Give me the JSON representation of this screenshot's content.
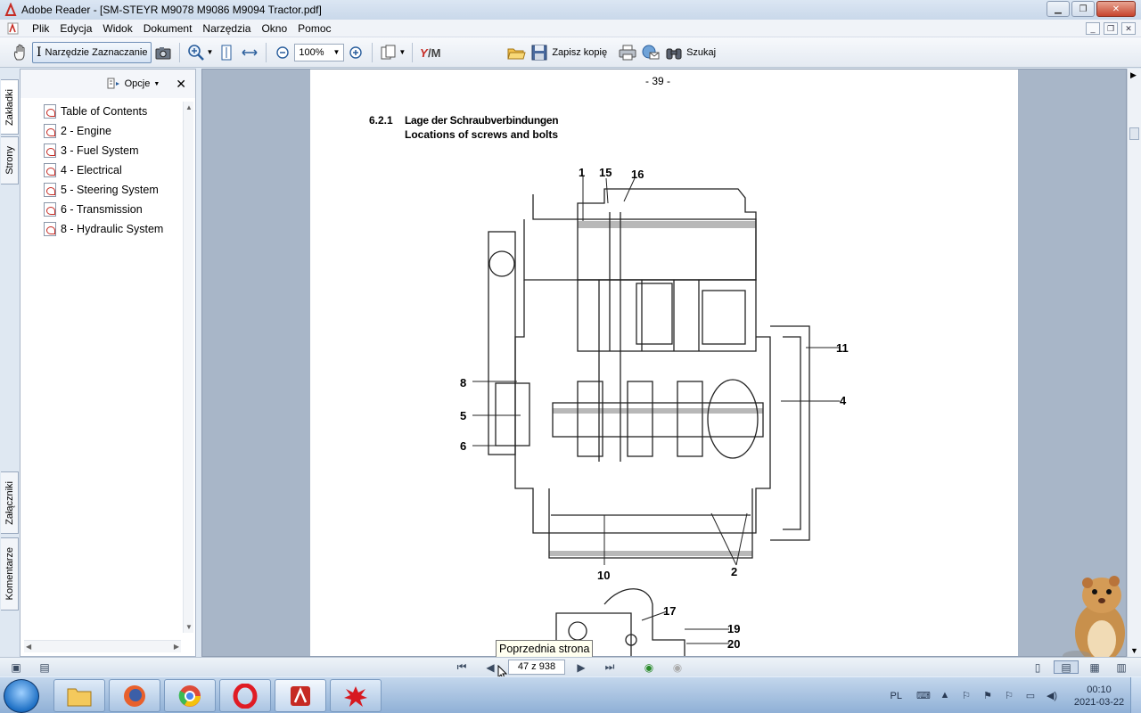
{
  "window": {
    "title": "Adobe Reader - [SM-STEYR M9078 M9086 M9094 Tractor.pdf]"
  },
  "menu": {
    "items": [
      "Plik",
      "Edycja",
      "Widok",
      "Dokument",
      "Narzędzia",
      "Okno",
      "Pomoc"
    ]
  },
  "toolbar": {
    "select_tool_label": "Narzędzie Zaznaczanie",
    "zoom_value": "100%",
    "save_copy_label": "Zapisz kopię",
    "search_label": "Szukaj"
  },
  "side_tabs": {
    "bookmarks": "Zakładki",
    "pages": "Strony",
    "attachments": "Załączniki",
    "comments": "Komentarze"
  },
  "bookmarks": {
    "options_label": "Opcje",
    "items": [
      "Table of Contents",
      "2 - Engine",
      "3 - Fuel System",
      "4 - Electrical",
      "5 - Steering System",
      "6 - Transmission",
      "8 - Hydraulic System"
    ]
  },
  "page": {
    "page_number_text": "- 39 -",
    "section_number": "6.2.1",
    "heading_de": "Lage der Schraubverbindungen",
    "heading_en": "Locations of screws and bolts",
    "callouts": [
      "1",
      "15",
      "16",
      "11",
      "4",
      "8",
      "5",
      "6",
      "10",
      "2",
      "17",
      "19",
      "20"
    ]
  },
  "tooltip": {
    "text": "Poprzednia strona"
  },
  "statusbar": {
    "page_indicator": "47 z 938"
  },
  "taskbar": {
    "language": "PL",
    "time": "00:10",
    "date": "2021-03-22"
  }
}
